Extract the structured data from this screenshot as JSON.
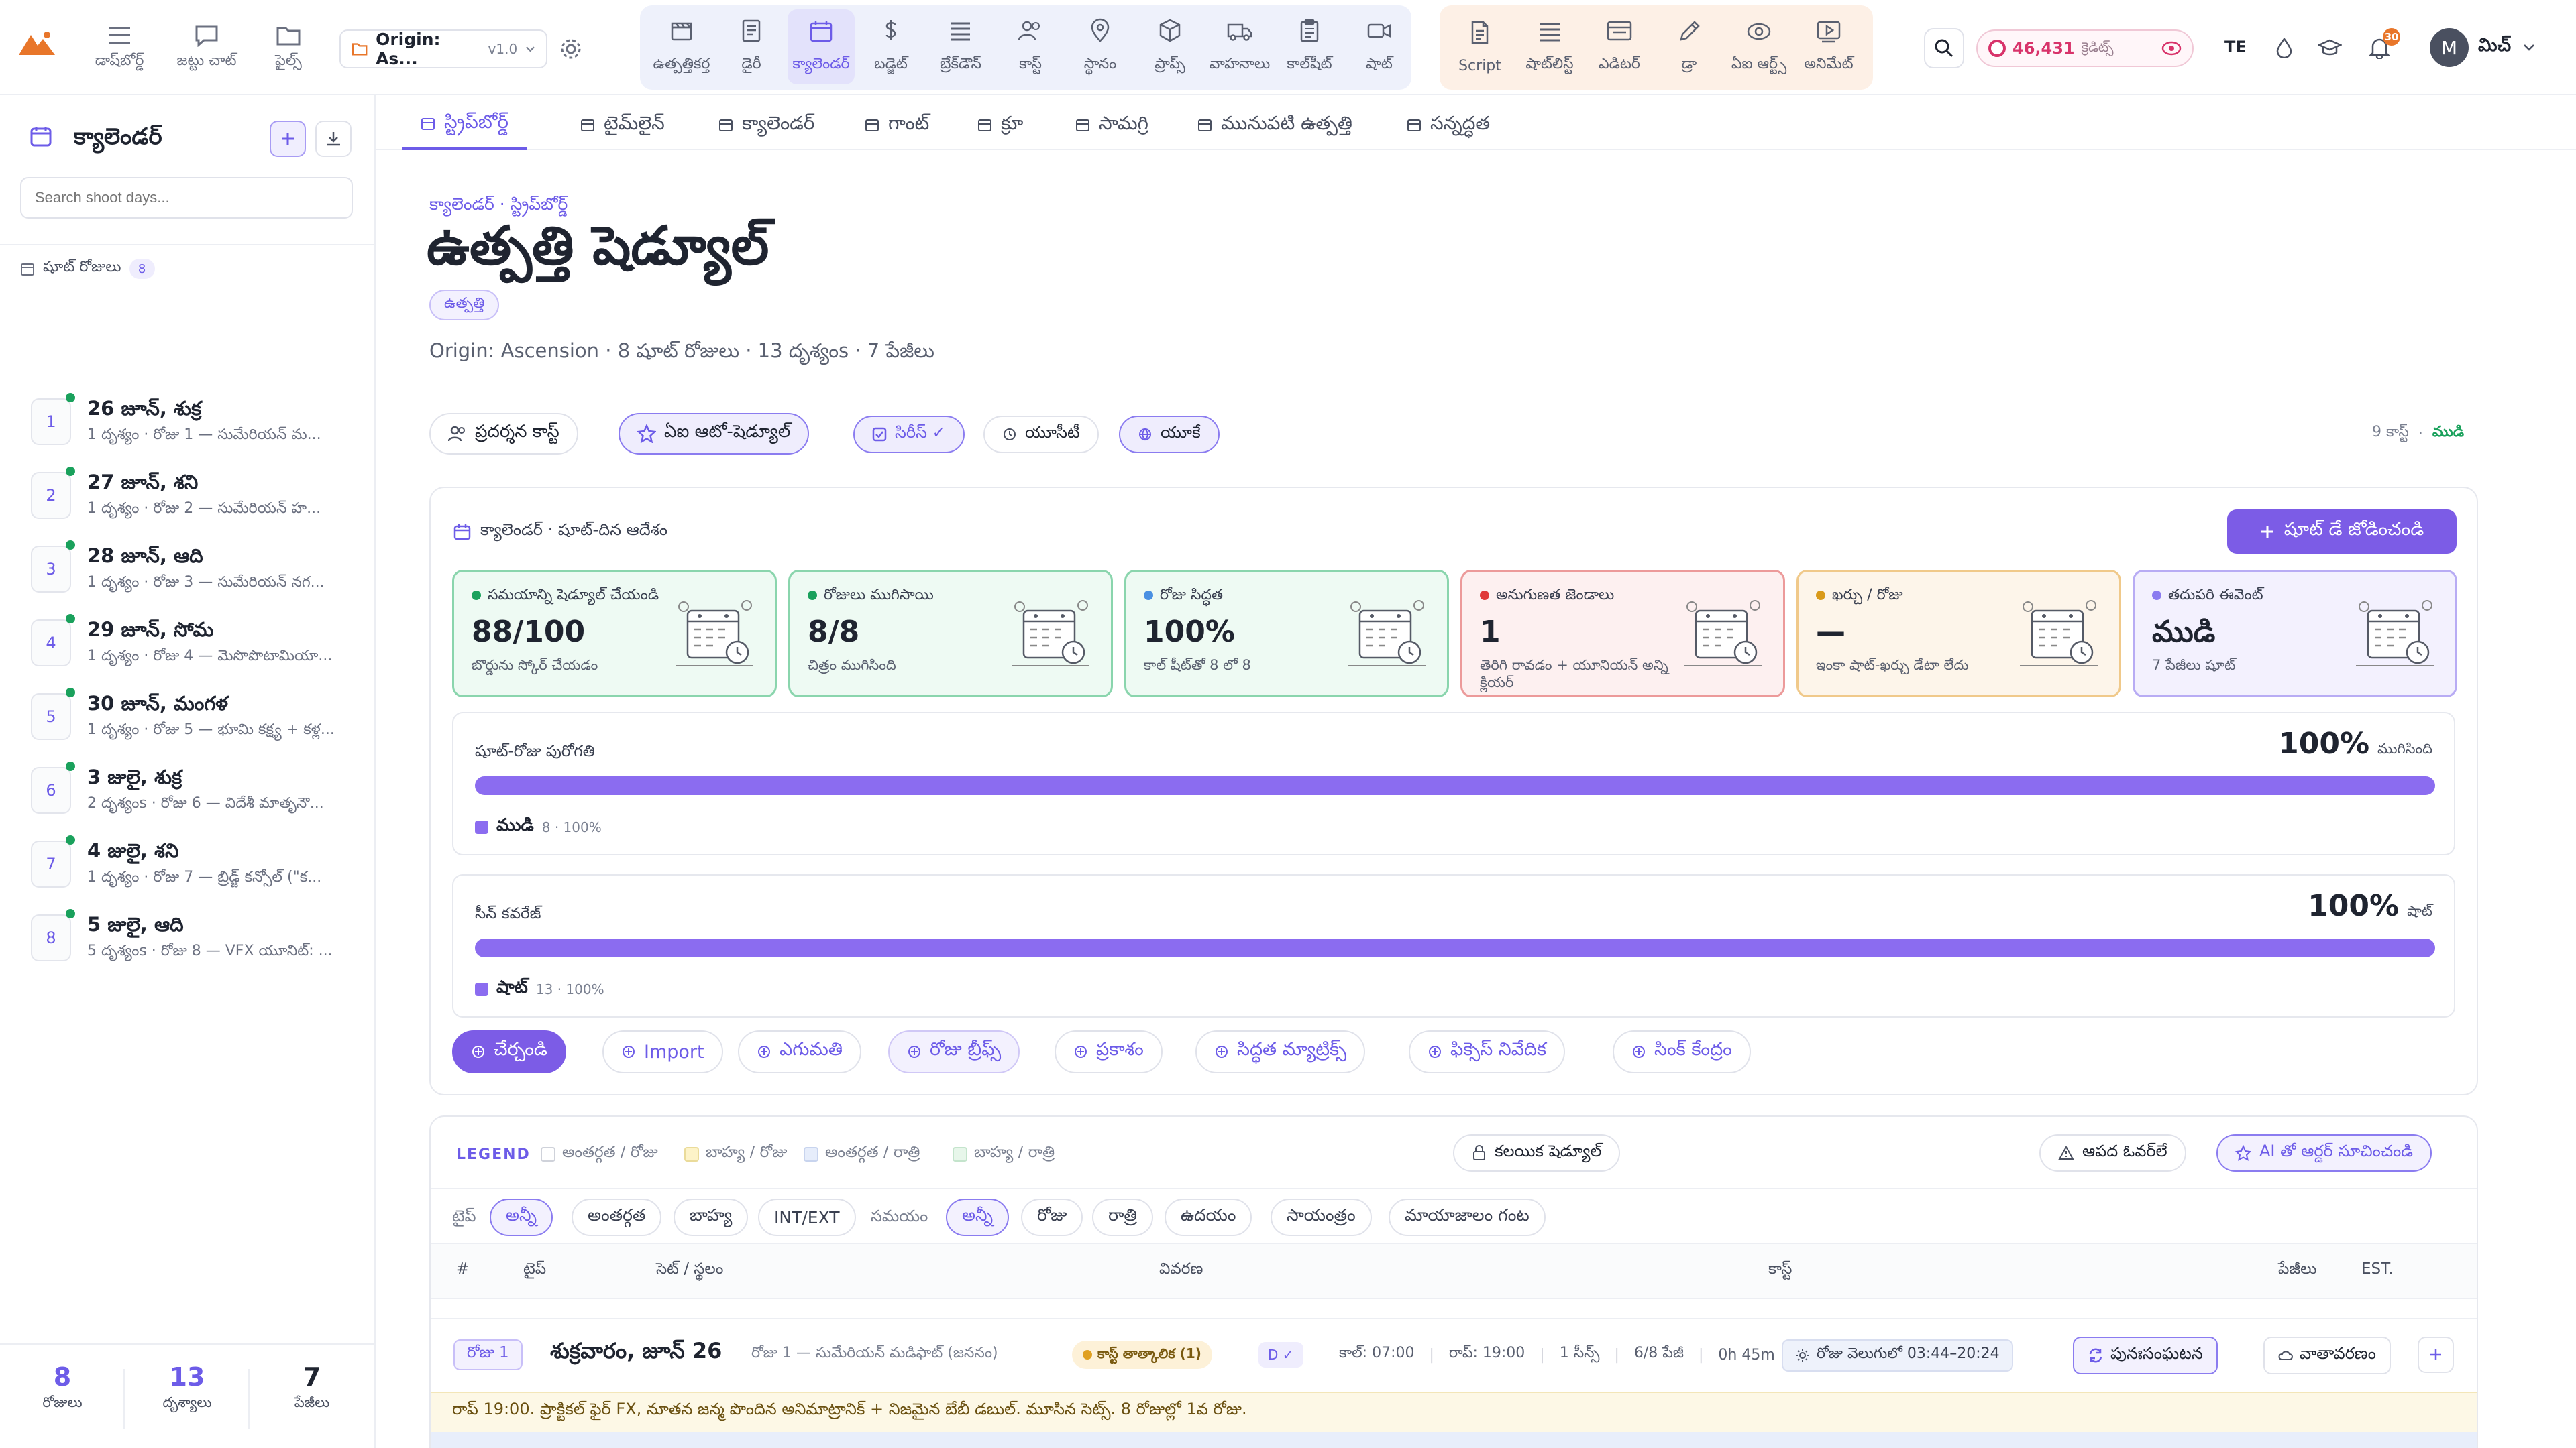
{
  "topnav": {
    "project_name": "Origin: As...",
    "version": "v1.0",
    "left_items": [
      "డాష్‌బోర్డ్",
      "జట్టు చాట్",
      "ఫైల్స్"
    ],
    "tools_a": [
      "ఉత్పత్తికర్త",
      "డైరీ",
      "క్యాలెండర్",
      "బడ్జెట్",
      "బ్రేక్‌డౌన్",
      "కాస్ట్",
      "స్థానం",
      "ప్రాప్స్",
      "వాహనాలు",
      "కాల్‌షీట్",
      "షాట్"
    ],
    "tools_b": [
      "Script",
      "షాట్‌లిస్ట్",
      "ఎడిటర్",
      "డ్రా",
      "ఏఐ ఆర్ట్స్",
      "అనిమేట్"
    ],
    "credits": "46,431",
    "credits_label": "క్రెడిట్స్",
    "lang": "TE",
    "notif_count": "30",
    "avatar_letter": "M",
    "user_name": "మిచ్"
  },
  "sidebar": {
    "title": "క్యాలెండర్",
    "search_placeholder": "Search shoot days...",
    "section_label": "షూట్ రోజులు",
    "section_count": "8",
    "days": [
      {
        "num": "1",
        "title": "26 జూన్, శుక్ర",
        "sub": "1 దృశ్యం · రోజు 1 — సుమేరియన్ మ..."
      },
      {
        "num": "2",
        "title": "27 జూన్, శని",
        "sub": "1 దృశ్యం · రోజు 2 — సుమేరియన్ హ..."
      },
      {
        "num": "3",
        "title": "28 జూన్, ఆది",
        "sub": "1 దృశ్యం · రోజు 3 — సుమేరియన్ నగ..."
      },
      {
        "num": "4",
        "title": "29 జూన్, సోమ",
        "sub": "1 దృశ్యం · రోజు 4 — మెసొపొటామియా..."
      },
      {
        "num": "5",
        "title": "30 జూన్, మంగళ",
        "sub": "1 దృశ్యం · రోజు 5 — భూమి కక్ష్య + కళ్ల..."
      },
      {
        "num": "6",
        "title": "3 జులై, శుక్ర",
        "sub": "2 దృశ్యంs · రోజు 6 — విదేశీ మాతృనౌ..."
      },
      {
        "num": "7",
        "title": "4 జులై, శని",
        "sub": "1 దృశ్యం · రోజు 7 — బ్రిడ్జ్ కన్సోల్ (\"క..."
      },
      {
        "num": "8",
        "title": "5 జులై, ఆది",
        "sub": "5 దృశ్యంs · రోజు 8 — VFX యూనిట్: ..."
      }
    ],
    "stats": [
      {
        "value": "8",
        "label": "రోజులు"
      },
      {
        "value": "13",
        "label": "దృశ్యాలు"
      },
      {
        "value": "7",
        "label": "పేజీలు"
      }
    ]
  },
  "subtabs": [
    "స్ట్రిప్‌బోర్డ్",
    "టైమ్‌లైన్",
    "క్యాలెండర్",
    "గాంట్",
    "క్రూ",
    "సామగ్రి",
    "మునుపటి ఉత్పత్తి",
    "సన్నద్ధత"
  ],
  "header": {
    "breadcrumb": "క్యాలెండర్ · స్ట్రిప్‌బోర్డ్",
    "title": "ఉత్పత్తి షెడ్యూల్",
    "badge": "ఉత్పత్తి",
    "meta": "Origin: Ascension · 8 షూట్ రోజులు · 13 దృశ్యంs · 7 పేజీలు"
  },
  "chips": {
    "cast": "ప్రదర్శన కాస్ట్",
    "ai_schedule": "ఏఐ ఆటో-షెడ్యూల్",
    "series": "సిరీస్ ✓",
    "utc": "యూసీటీ",
    "uk": "యూకే",
    "right_count": "9 కాస్ట్",
    "right_status": "ముడి"
  },
  "panel": {
    "heading": "క్యాలెండర్ · షూట్-దిన ఆదేశం",
    "add_button": "షూట్ డే జోడించండి",
    "cards": [
      {
        "label": "సమయాన్ని షెడ్యూల్ చేయండి",
        "value": "88/100",
        "sub": "బొర్డును స్కోర్ చేయడం",
        "dot": "#1aa15c"
      },
      {
        "label": "రోజులు ముగిసాయి",
        "value": "8/8",
        "sub": "చిత్రం ముగిసింది",
        "dot": "#1aa15c"
      },
      {
        "label": "రోజు సిద్ధత",
        "value": "100%",
        "sub": "కాల్ షీట్‌తో 8 లో 8",
        "dot": "#4a90e2"
      },
      {
        "label": "అనుగుణత జెండాలు",
        "value": "1",
        "sub": "తెరిగి రావడం + యూనియన్ అన్ని క్లియర్",
        "dot": "#e03a3a"
      },
      {
        "label": "ఖర్చు / రోజు",
        "value": "—",
        "sub": "ఇంకా షాట్-ఖర్చు డేటా లేదు",
        "dot": "#d99a1a"
      },
      {
        "label": "తదుపరి ఈవెంట్",
        "value": "ముడి",
        "sub": "7 పేజీలు షూట్",
        "dot": "#8b7cf0"
      }
    ],
    "progress": [
      {
        "title": "షూట్-రోజు పురోగతి",
        "pct": "100%",
        "pct_label": "ముగిసింది",
        "fill": 1.0,
        "legend": "ముడి",
        "legend_detail": "8 · 100%"
      },
      {
        "title": "సీన్ కవరేజ్",
        "pct": "100%",
        "pct_label": "షాట్",
        "fill": 1.0,
        "legend": "షాట్",
        "legend_detail": "13 · 100%"
      }
    ],
    "actions": [
      "చేర్చండి",
      "Import",
      "ఎగుమతి",
      "రోజు బ్రీఫ్స్",
      "ప్రకాశం",
      "సిద్ధత మ్యాట్రిక్స్",
      "ఫిక్సెస్ నివేదిక",
      "సింక్ కేంద్రం"
    ]
  },
  "strip": {
    "legend_title": "LEGEND",
    "legend_items": [
      "అంతర్గత / రోజు",
      "బాహ్య / రోజు",
      "అంతర్గత / రాత్రి",
      "బాహ్య / రాత్రి"
    ],
    "lock_button": "కలయిక షెడ్యూల్",
    "hazard_button": "ఆపద ఓవర్‌లే",
    "ai_order_button": "AI తో ఆర్డర్ సూచించండి",
    "type_label": "టైప్",
    "type_chips": [
      "అన్నీ",
      "అంతర్గత",
      "బాహ్య",
      "INT/EXT"
    ],
    "time_label": "సమయం",
    "time_chips": [
      "అన్నీ",
      "రోజు",
      "రాత్రి",
      "ఉదయం",
      "సాయంత్రం",
      "మాయాజాలం గంట"
    ],
    "columns": [
      "#",
      "టైప్",
      "సెట్ / స్థలం",
      "వివరణ",
      "కాస్ట్",
      "పేజీలు",
      "EST."
    ],
    "day_banner": {
      "day": "రోజు 1",
      "date": "శుక్రవారం, జూన్ 26",
      "location": "రోజు 1 — సుమేరియన్ మడిఫాట్ (జననం)",
      "cast_badge": "కాస్ట్ తాత్కాలిక (1)",
      "d_badge": "D ✓",
      "call": "కాల్: 07:00",
      "wrap": "రాప్: 19:00",
      "scenes": "1 సీన్స్",
      "pages": "6/8 పేజీ",
      "duration": "0h 45m",
      "daylight": "రోజు వెలుగులో 03:44–20:24",
      "rebuild": "పునఃసంఘటన",
      "weather": "వాతావరణం"
    },
    "note": "రాప్ 19:00. ప్రాక్టికల్ ఫైర్ FX, నూతన జన్మ పొందిన అనిమాట్రానిక్ + నిజమైన బేబీ డబుల్. మూసిన సెట్స్. 8 రోజుల్లో 1వ రోజు."
  },
  "colors": {
    "accent": "#6d5ce8",
    "progress": "#8b6cf0",
    "green": "#1aa15c",
    "red": "#e03a3a"
  }
}
